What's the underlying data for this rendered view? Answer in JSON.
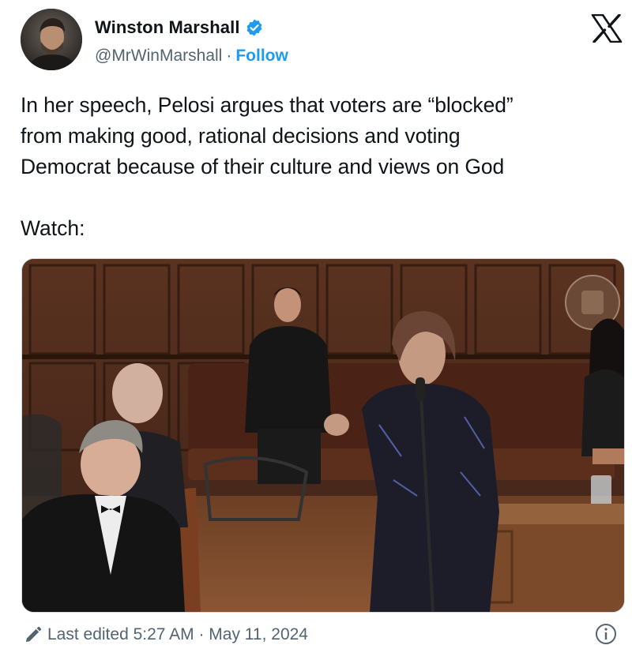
{
  "author": {
    "name": "Winston Marshall",
    "handle": "@MrWinMarshall",
    "separator": "·",
    "follow_label": "Follow",
    "verified_color": "#1d9bf0"
  },
  "platform_icon": "x-logo-icon",
  "tweet": {
    "lines": [
      "In her speech, Pelosi argues that voters are “blocked”",
      "from making good, rational decisions and voting",
      "Democrat because of their culture and views on God"
    ],
    "watch_label": "Watch:"
  },
  "media": {
    "type": "video-thumbnail",
    "content": "speaker-at-lectern-in-wood-paneled-hall"
  },
  "footer": {
    "edited_label": "Last edited 5:27 AM · May 11, 2024",
    "edit_icon": "pencil-icon",
    "info_icon": "info-icon"
  },
  "colors": {
    "text": "#0f1419",
    "secondary": "#536471",
    "accent": "#1d9bf0"
  }
}
